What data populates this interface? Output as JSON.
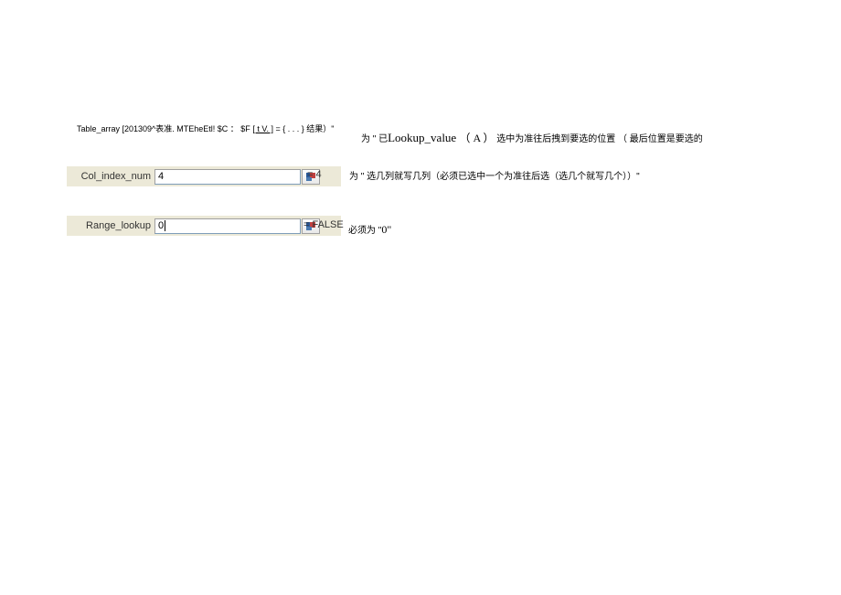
{
  "row1": {
    "left_prefix": "Table_array [201309^表准. MTEheEtl! $C ： $F ",
    "left_underline": "[ t V. ]",
    "left_suffix": " = { . . . } 结果）\"",
    "right_prefix": "为 \" 已",
    "right_lookup": "Lookup_value ",
    "right_paren": "（ A ）",
    "right_suffix": " 选中为准往后拽到要选的位置 （ 最后位置是要选的"
  },
  "row2": {
    "label": "Col_index_num",
    "value": "4",
    "result": "= 4",
    "note": "为 \" 选几列就写几列（必须已选中一个为准往后选（选几个就写几个））\""
  },
  "row3": {
    "label": "Range_lookup",
    "value": "0",
    "result": "= FALSE",
    "note_prefix": "必须为 \"",
    "note_zero": "0\""
  }
}
